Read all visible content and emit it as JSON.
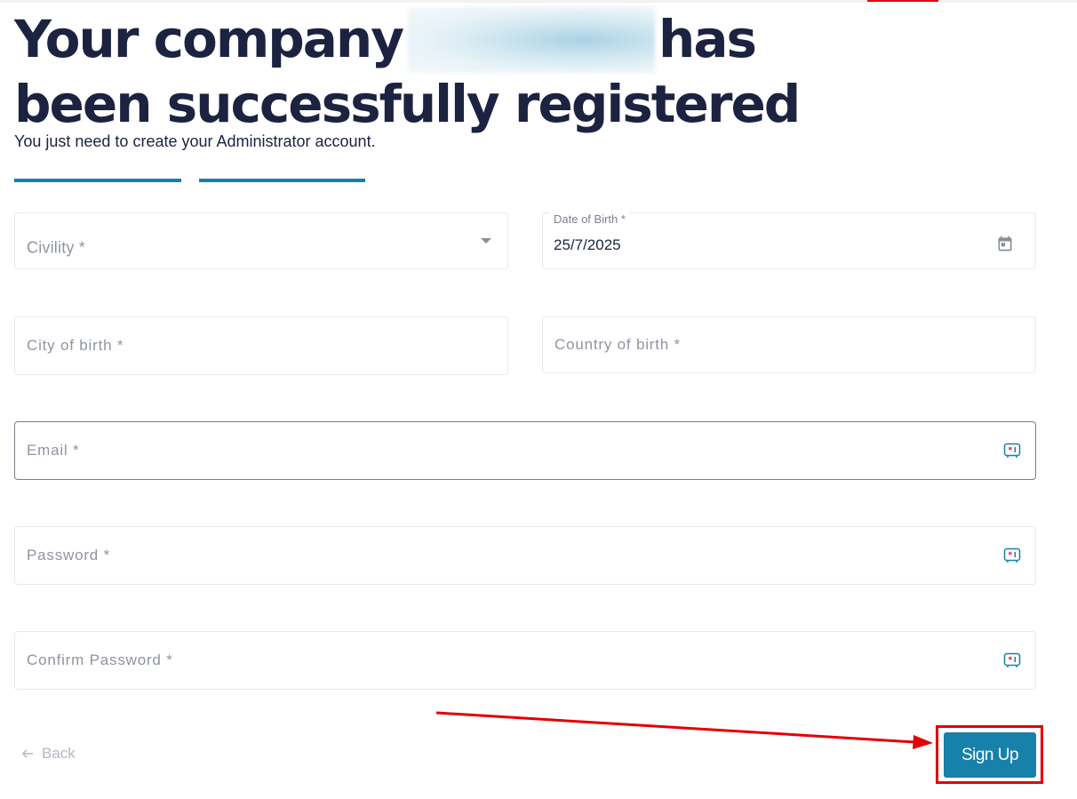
{
  "header": {
    "title_part1": "Your company",
    "title_part2": "has been successfully registered",
    "subtitle": "You just need to create your Administrator account."
  },
  "progress": {
    "steps_total": 2,
    "steps_filled": 2
  },
  "form": {
    "civility": {
      "placeholder": "Civility *",
      "icon": "chevron-down-icon"
    },
    "date_of_birth": {
      "label": "Date of Birth *",
      "value": "25/7/2025",
      "icon": "calendar-icon"
    },
    "city_of_birth": {
      "placeholder": "City of birth *"
    },
    "country_of_birth": {
      "placeholder": "Country of birth *"
    },
    "email": {
      "placeholder": "Email *",
      "icon": "password-manager-icon"
    },
    "password": {
      "placeholder": "Password *",
      "icon": "password-manager-icon"
    },
    "confirm_password": {
      "placeholder": "Confirm Password *",
      "icon": "password-manager-icon"
    }
  },
  "footer": {
    "back_label": "Back",
    "signup_label": "Sign Up"
  },
  "colors": {
    "accent": "#1780ab",
    "heading": "#1c2340",
    "annotation": "#e30000"
  }
}
